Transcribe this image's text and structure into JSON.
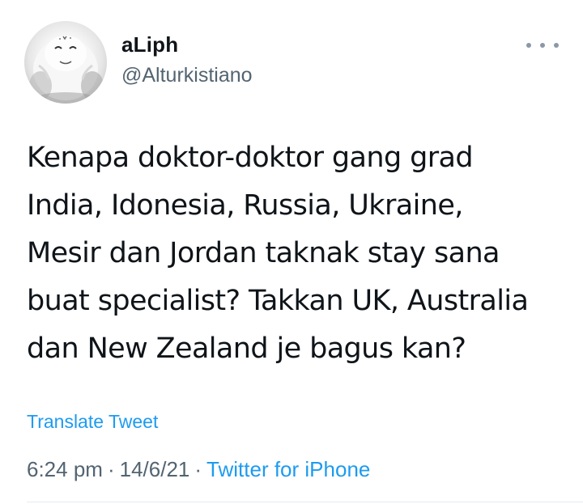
{
  "author": {
    "display_name": "aLiph",
    "handle": "@Alturkistiano",
    "avatar_icon": "snowman-avatar"
  },
  "tweet": {
    "text": "Kenapa doktor-doktor gang grad\nIndia, Idonesia, Russia, Ukraine,\nMesir dan Jordan taknak stay sana\nbuat specialist? Takkan UK, Australia\ndan New Zealand je bagus kan?",
    "translate_label": "Translate Tweet",
    "time": "6:24 pm",
    "date": "14/6/21",
    "separator": "·",
    "source": "Twitter for iPhone"
  },
  "icons": {
    "more": "more-horizontal-icon"
  },
  "colors": {
    "link": "#1d9bf0",
    "secondary_text": "#536471",
    "primary_text": "#0f1419"
  }
}
